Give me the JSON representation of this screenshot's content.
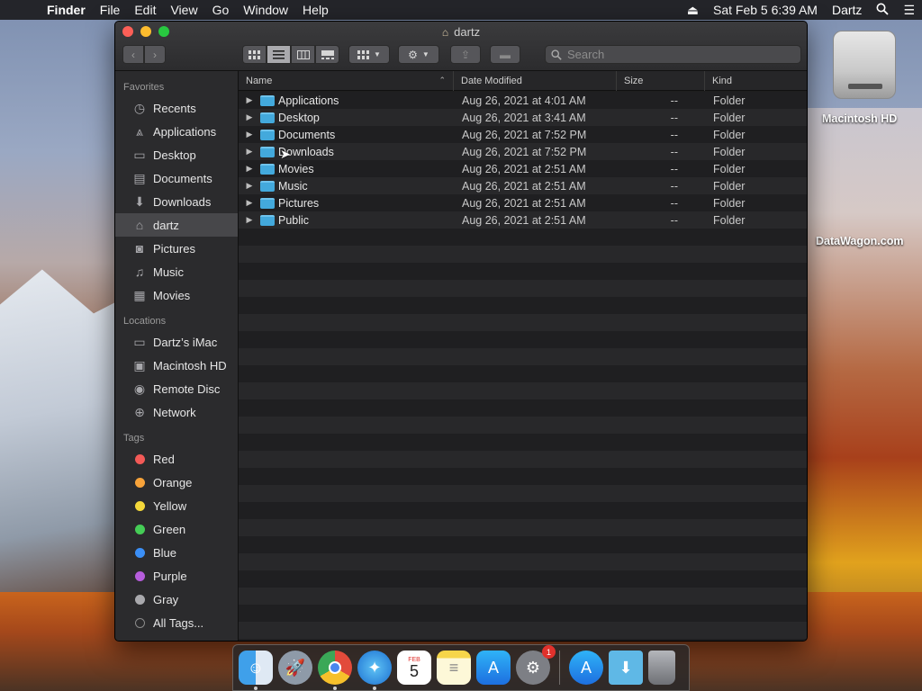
{
  "menubar": {
    "app_name": "Finder",
    "items": [
      "File",
      "Edit",
      "View",
      "Go",
      "Window",
      "Help"
    ],
    "datetime": "Sat Feb 5  6:39 AM",
    "user": "Dartz",
    "icons": [
      "apple-icon",
      "eject-icon",
      "spotlight-icon",
      "notification-center-icon"
    ]
  },
  "window": {
    "title": "dartz",
    "title_icon": "home-icon",
    "search_placeholder": "Search",
    "view_modes": [
      "icon-view",
      "list-view",
      "column-view",
      "gallery-view"
    ],
    "active_view": "list-view"
  },
  "sidebar": {
    "favorites_header": "Favorites",
    "favorites": [
      {
        "label": "Recents",
        "icon": "clock-icon"
      },
      {
        "label": "Applications",
        "icon": "applications-icon"
      },
      {
        "label": "Desktop",
        "icon": "desktop-icon"
      },
      {
        "label": "Documents",
        "icon": "document-icon"
      },
      {
        "label": "Downloads",
        "icon": "download-icon"
      },
      {
        "label": "dartz",
        "icon": "home-icon",
        "selected": true
      },
      {
        "label": "Pictures",
        "icon": "camera-icon"
      },
      {
        "label": "Music",
        "icon": "music-icon"
      },
      {
        "label": "Movies",
        "icon": "film-icon"
      }
    ],
    "locations_header": "Locations",
    "locations": [
      {
        "label": "Dartz’s iMac",
        "icon": "computer-icon"
      },
      {
        "label": "Macintosh HD",
        "icon": "hard-drive-icon"
      },
      {
        "label": "Remote Disc",
        "icon": "disc-icon"
      },
      {
        "label": "Network",
        "icon": "network-icon"
      }
    ],
    "tags_header": "Tags",
    "tags": [
      {
        "label": "Red",
        "color": "#f35a57"
      },
      {
        "label": "Orange",
        "color": "#f8a33a"
      },
      {
        "label": "Yellow",
        "color": "#f4d83a"
      },
      {
        "label": "Green",
        "color": "#45cd56"
      },
      {
        "label": "Blue",
        "color": "#3b8ff6"
      },
      {
        "label": "Purple",
        "color": "#b65ddc"
      },
      {
        "label": "Gray",
        "color": "#a9a9ad"
      },
      {
        "label": "All Tags...",
        "color": "outline"
      }
    ]
  },
  "main": {
    "columns": {
      "name": "Name",
      "date": "Date Modified",
      "size": "Size",
      "kind": "Kind"
    },
    "rows": [
      {
        "name": "Applications",
        "date": "Aug 26, 2021 at 4:01 AM",
        "size": "--",
        "kind": "Folder"
      },
      {
        "name": "Desktop",
        "date": "Aug 26, 2021 at 3:41 AM",
        "size": "--",
        "kind": "Folder"
      },
      {
        "name": "Documents",
        "date": "Aug 26, 2021 at 7:52 PM",
        "size": "--",
        "kind": "Folder"
      },
      {
        "name": "Downloads",
        "date": "Aug 26, 2021 at 7:52 PM",
        "size": "--",
        "kind": "Folder"
      },
      {
        "name": "Movies",
        "date": "Aug 26, 2021 at 2:51 AM",
        "size": "--",
        "kind": "Folder"
      },
      {
        "name": "Music",
        "date": "Aug 26, 2021 at 2:51 AM",
        "size": "--",
        "kind": "Folder"
      },
      {
        "name": "Pictures",
        "date": "Aug 26, 2021 at 2:51 AM",
        "size": "--",
        "kind": "Folder"
      },
      {
        "name": "Public",
        "date": "Aug 26, 2021 at 2:51 AM",
        "size": "--",
        "kind": "Folder"
      }
    ]
  },
  "desktop": {
    "drive_label": "Macintosh HD",
    "watermark": "DataWagon.com"
  },
  "dock": {
    "apps": [
      "finder",
      "launchpad",
      "chrome",
      "safari",
      "calendar",
      "notes",
      "app-store",
      "system-preferences"
    ],
    "calendar_month": "FEB",
    "calendar_day": "5",
    "system_preferences_badge": "1",
    "after_separator": [
      "app-store-download",
      "downloads-folder",
      "trash"
    ]
  }
}
